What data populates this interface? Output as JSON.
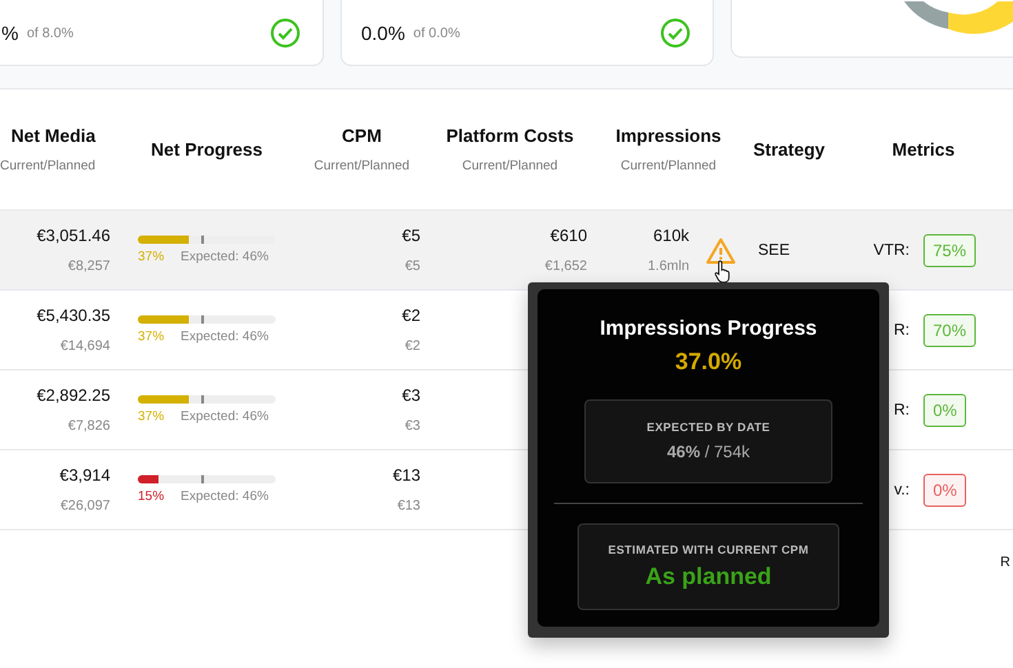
{
  "cards": [
    {
      "value": "%",
      "target": "of 8.0%",
      "ok": true
    },
    {
      "value": "0.0%",
      "target": "of 0.0%",
      "ok": true
    }
  ],
  "table": {
    "columns": [
      {
        "title": "Net Media",
        "subtitle": "Current/Planned"
      },
      {
        "title": "Net Progress"
      },
      {
        "title": "CPM",
        "subtitle": "Current/Planned"
      },
      {
        "title": "Platform Costs",
        "subtitle": "Current/Planned"
      },
      {
        "title": "Impressions",
        "subtitle": "Current/Planned"
      },
      {
        "title": "Strategy"
      },
      {
        "title": "Metrics"
      }
    ],
    "rows": [
      {
        "highlighted": true,
        "net_media": "€3,051.46",
        "net_media_planned": "€8,257",
        "progress": {
          "level": 0.37,
          "expected_marker": {
            "level": 0.46
          },
          "percent": "37%",
          "expected_label": "Expected: 46%",
          "color": "#d4b000"
        },
        "cpm": "€5",
        "cpm_planned": "€5",
        "platform_costs": "€610",
        "platform_costs_planned": "€1,652",
        "impressions": "610k",
        "impressions_planned": "1.6mln",
        "warning": true,
        "strategy": "SEE",
        "metric_label": "VTR:",
        "metric_value": "75%",
        "color": "#5cb83a"
      },
      {
        "highlighted": false,
        "net_media": "€5,430.35",
        "net_media_planned": "€14,694",
        "progress": {
          "level": 0.37,
          "expected_marker": {
            "level": 0.46
          },
          "percent": "37%",
          "expected_label": "Expected: 46%",
          "color": "#d4b000"
        },
        "cpm": "€2",
        "cpm_planned": "€2",
        "metric_label": "R:",
        "metric_value": "70%",
        "color": "#5cb83a"
      },
      {
        "highlighted": false,
        "net_media": "€2,892.25",
        "net_media_planned": "€7,826",
        "progress": {
          "level": 0.37,
          "expected_marker": {
            "level": 0.46
          },
          "percent": "37%",
          "expected_label": "Expected: 46%",
          "color": "#d4b000"
        },
        "cpm": "€3",
        "cpm_planned": "€3",
        "metric_label": "R:",
        "metric_value": "0%",
        "color": "#5cb83a"
      },
      {
        "highlighted": false,
        "net_media": "€3,914",
        "net_media_planned": "€26,097",
        "progress": {
          "level": 0.15,
          "expected_marker": {
            "level": 0.46
          },
          "percent": "15%",
          "expected_label": "Expected: 46%",
          "color": "#d0202a"
        },
        "cpm": "€13",
        "cpm_planned": "€13",
        "metric_label": "v.:",
        "metric_value": "0%",
        "color": "#e86060"
      }
    ]
  },
  "footer_fragment": "R",
  "tooltip": {
    "title": "Impressions Progress",
    "value": "37.0%",
    "expected_heading": "EXPECTED BY DATE",
    "expected_value": "**46%** / 754k",
    "estimate_heading": "ESTIMATED WITH CURRENT CPM",
    "estimate_value": "As planned"
  }
}
